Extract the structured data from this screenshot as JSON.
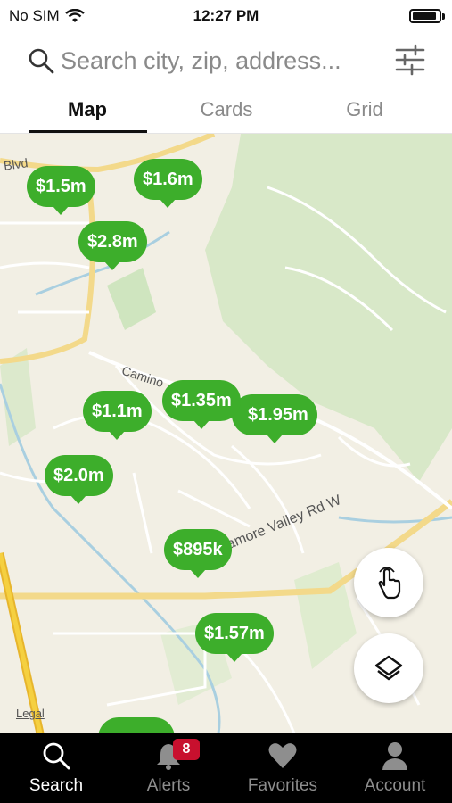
{
  "status_bar": {
    "carrier": "No SIM",
    "time": "12:27 PM"
  },
  "search": {
    "placeholder": "Search city, zip, address..."
  },
  "tabs": [
    {
      "label": "Map",
      "active": true
    },
    {
      "label": "Cards",
      "active": false
    },
    {
      "label": "Grid",
      "active": false
    }
  ],
  "map": {
    "road_labels": {
      "blvd": "Blvd",
      "camino": "Camino",
      "sycamore": "Sycamore Valley Rd W"
    },
    "pins": [
      {
        "price": "$1.5m"
      },
      {
        "price": "$1.6m"
      },
      {
        "price": "$2.8m"
      },
      {
        "price": "$1.1m"
      },
      {
        "price": "$1.35m"
      },
      {
        "price": "$1.95m"
      },
      {
        "price": "$2.0m"
      },
      {
        "price": "$895k"
      },
      {
        "price": "$1.57m"
      }
    ],
    "legal": "Legal",
    "pin_color": "#3dae2b"
  },
  "bottom_nav": {
    "items": [
      {
        "label": "Search",
        "icon": "search-icon",
        "active": true
      },
      {
        "label": "Alerts",
        "icon": "bell-icon",
        "active": false,
        "badge": "8"
      },
      {
        "label": "Favorites",
        "icon": "heart-icon",
        "active": false
      },
      {
        "label": "Account",
        "icon": "person-icon",
        "active": false
      }
    ]
  }
}
